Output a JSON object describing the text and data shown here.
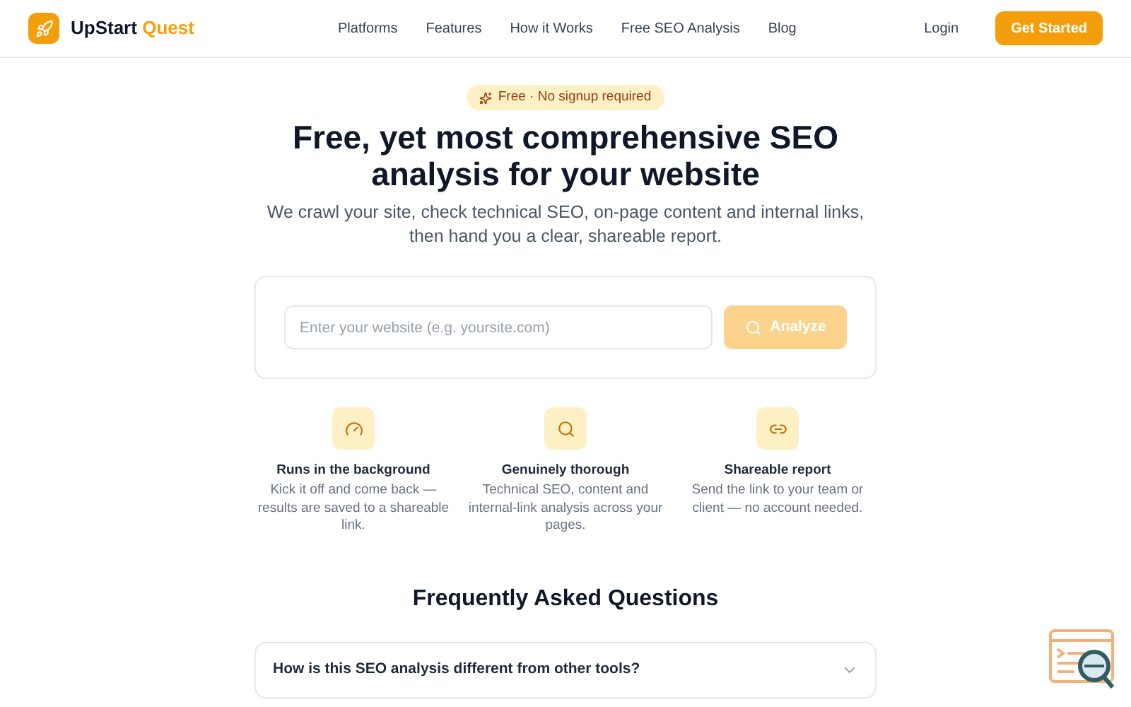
{
  "brand": {
    "name": "UpStart",
    "accent": "Quest"
  },
  "nav": [
    "Platforms",
    "Features",
    "How it Works",
    "Free SEO Analysis",
    "Blog"
  ],
  "login": "Login",
  "cta": "Get Started",
  "badge": "Free · No signup required",
  "hero": {
    "title_line1": "Free, yet most comprehensive SEO",
    "title_line2": "analysis for your website",
    "subtitle_line1": "We crawl your site, check technical SEO, on-page content and internal links,",
    "subtitle_line2": "then hand you a clear, shareable report."
  },
  "form": {
    "placeholder": "Enter your website (e.g. yoursite.com)",
    "button": "Analyze",
    "disabled": true
  },
  "features": [
    {
      "kind": "gauge",
      "title": "Runs in the background",
      "text": "Kick it off and come back — results are saved to a shareable link."
    },
    {
      "kind": "search",
      "title": "Genuinely thorough",
      "text": "Technical SEO, content and internal-link analysis across your pages."
    },
    {
      "kind": "link",
      "title": "Shareable report",
      "text": "Send the link to your team or client — no account needed."
    }
  ],
  "faq": {
    "title": "Frequently Asked Questions",
    "items": [
      {
        "question": "How is this SEO analysis different from other tools?",
        "expanded": false
      }
    ]
  }
}
